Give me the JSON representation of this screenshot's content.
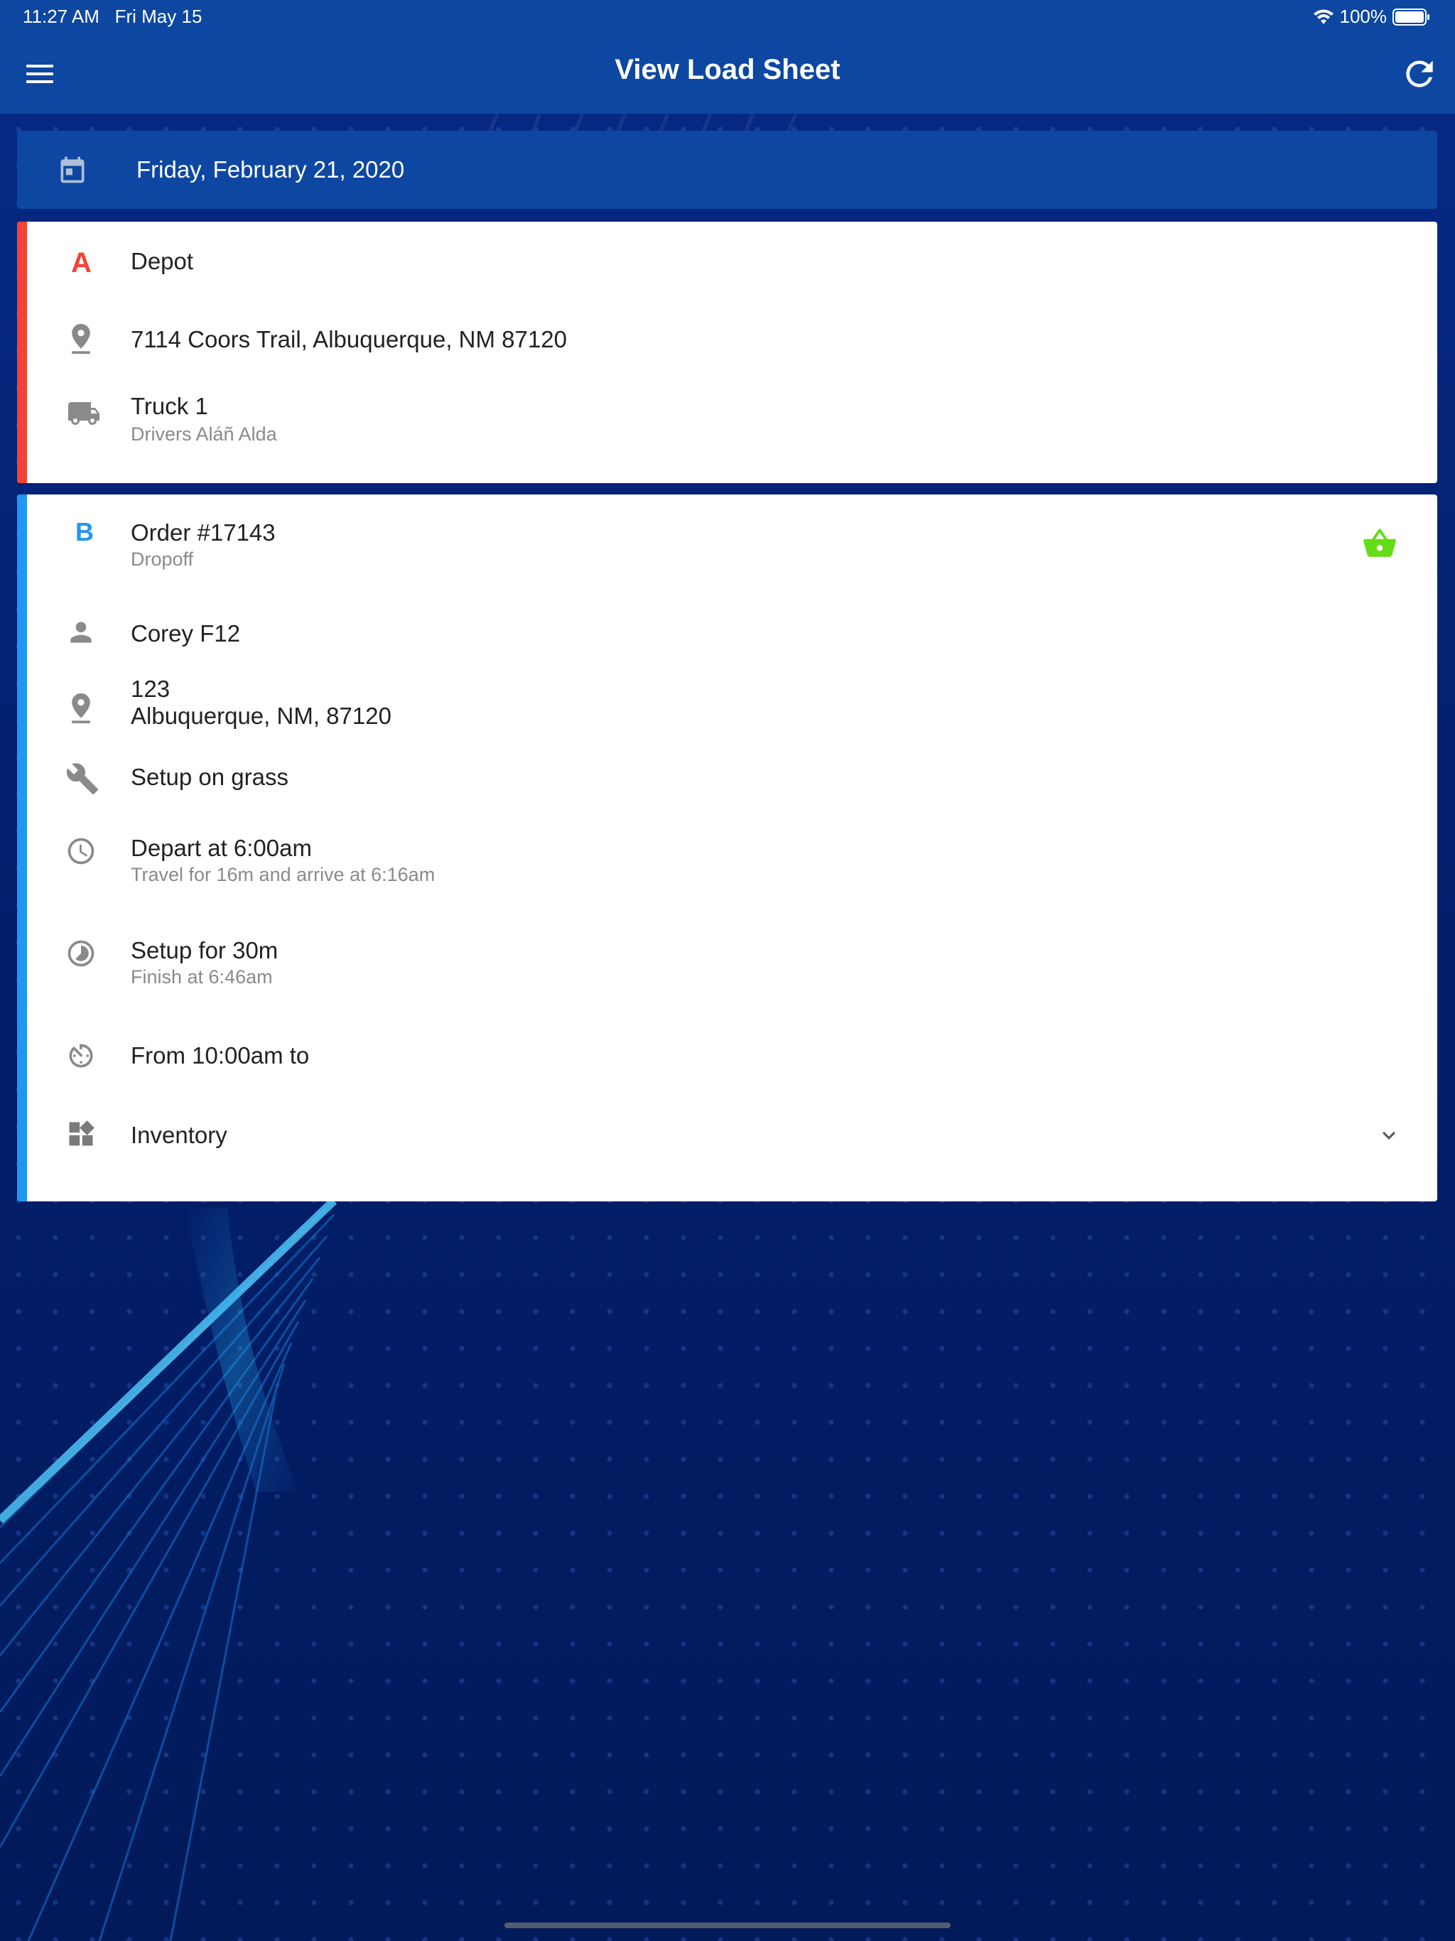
{
  "status_bar": {
    "time": "11:27 AM",
    "date": "Fri May 15",
    "battery": "100%"
  },
  "header": {
    "title": "View Load Sheet",
    "menu_icon": "hamburger-menu-icon",
    "refresh_icon": "refresh-icon"
  },
  "date_bar": {
    "date": "Friday, February 21, 2020",
    "icon": "calendar-icon"
  },
  "depot_card": {
    "accent": "#f44336",
    "marker": "A",
    "name": "Depot",
    "address": "7114 Coors Trail, Albuquerque, NM 87120",
    "truck": "Truck 1",
    "drivers": "Drivers Aláñ Alda"
  },
  "order_card": {
    "accent": "#2196f3",
    "marker": "B",
    "order": "Order #17143",
    "type": "Dropoff",
    "status_icon": "basket-icon",
    "status_color": "#64dd17",
    "customer": "Corey F12",
    "address_line1": "123",
    "address_line2": "Albuquerque, NM, 87120",
    "setup_note": "Setup on grass",
    "depart": "Depart at 6:00am",
    "travel": "Travel for 16m and arrive at 6:16am",
    "setup_duration": "Setup for 30m",
    "finish": "Finish at 6:46am",
    "window": "From 10:00am to",
    "inventory_label": "Inventory"
  }
}
